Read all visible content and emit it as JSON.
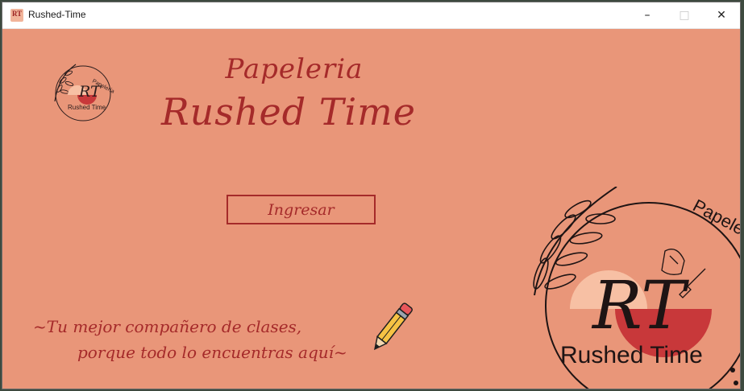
{
  "window": {
    "title": "Rushed-Time",
    "controls": {
      "minimize": "–",
      "maximize": "□",
      "close": "✕"
    }
  },
  "header": {
    "line1": "Papeleria",
    "line2": "Rushed Time"
  },
  "login": {
    "button_label": "Ingresar"
  },
  "tagline": {
    "line1": "~Tu mejor compañero de clases,",
    "line2": "porque todo lo encuentras aquí~"
  },
  "logo": {
    "monogram": "RT",
    "arc_text": "Papelería",
    "name": "Rushed Time"
  },
  "colors": {
    "background": "#e99679",
    "accent": "#a52a2a",
    "logo_red": "#c8383a",
    "logo_peach": "#f7c0a4"
  },
  "icons": {
    "app": "app-icon",
    "pencil": "pencil-icon",
    "logo": "brand-logo"
  }
}
